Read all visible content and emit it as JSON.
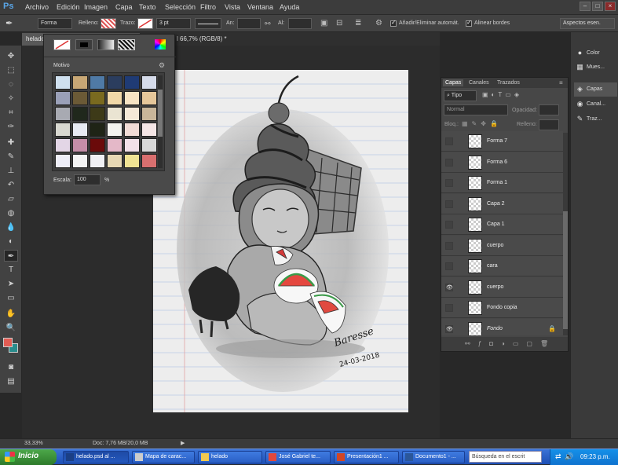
{
  "app": {
    "logo": "Ps"
  },
  "menu": [
    "Archivo",
    "Edición",
    "Imagen",
    "Capa",
    "Texto",
    "Selección",
    "Filtro",
    "Vista",
    "Ventana",
    "Ayuda"
  ],
  "window_buttons": [
    "–",
    "□",
    "×"
  ],
  "options": {
    "mode": "Forma",
    "fill_label": "Relleno:",
    "stroke_label": "Trazo:",
    "stroke_size": "3 pt",
    "width_label": "An:",
    "height_label": "Al:",
    "auto_add_label": "Añadir/Eliminar automát.",
    "align_edges_label": "Alinear bordes",
    "workspace": "Aspectos esen."
  },
  "document_tab": {
    "title": "helado",
    "title_rest": "l 66,7% (RGB/8) *"
  },
  "pattern_panel": {
    "title": "Motivo",
    "scale_label": "Escala:",
    "scale_value": "100",
    "scale_unit": "%",
    "swatches": [
      [
        "#cfe0ef",
        "#c8a775",
        "#4f7aa6",
        "#2b3d5e",
        "#1f3b75",
        "#d5dbea"
      ],
      [
        "#9aa0b8",
        "#6b5a36",
        "#7a6a1f",
        "#f2d9a8",
        "#f7e4c4",
        "#e6c79a"
      ],
      [
        "#a8aab2",
        "#20281c",
        "#3d3a18",
        "#eae4d2",
        "#f5e9d8",
        "#c9b69a"
      ],
      [
        "#d8d8d0",
        "#e8eaf4",
        "#1f2416",
        "#f4f4f0",
        "#f2dcd6",
        "#f5e6e6"
      ],
      [
        "#e3d6e6",
        "#c48ea8",
        "#6a0a0a",
        "#e4b8c8",
        "#f2e0e8",
        "#d9d9d9"
      ],
      [
        "#eeeef8",
        "#f4f4f4",
        "#f0f0f4",
        "#e7d8b4",
        "#f0e394",
        "#d96f6f"
      ]
    ]
  },
  "dock": [
    {
      "icon": "palette-icon",
      "glyph": "●",
      "label": "Color"
    },
    {
      "icon": "grid-icon",
      "glyph": "▦",
      "label": "Mues..."
    },
    {
      "icon": "layers-icon",
      "glyph": "◈",
      "label": "Capas"
    },
    {
      "icon": "channels-icon",
      "glyph": "◉",
      "label": "Canal..."
    },
    {
      "icon": "paths-icon",
      "glyph": "✎",
      "label": "Traz..."
    }
  ],
  "layers_panel": {
    "tabs": [
      "Capas",
      "Canales",
      "Trazados"
    ],
    "filter": "Tipo",
    "blend_mode": "Normal",
    "opacity_label": "Opacidad:",
    "lock_label": "Bloq.:",
    "fill_label": "Relleno:",
    "layers": [
      {
        "name": "Forma 7",
        "visible": false,
        "italic": false
      },
      {
        "name": "Forma 6",
        "visible": false,
        "italic": false
      },
      {
        "name": "Forma 1",
        "visible": false,
        "italic": false
      },
      {
        "name": "Capa 2",
        "visible": false,
        "italic": false
      },
      {
        "name": "Capa 1",
        "visible": false,
        "italic": false
      },
      {
        "name": "cuerpo",
        "visible": false,
        "italic": false
      },
      {
        "name": "cara",
        "visible": false,
        "italic": false
      },
      {
        "name": "cuerpo",
        "visible": true,
        "italic": false
      },
      {
        "name": "Fondo copia",
        "visible": false,
        "italic": false
      },
      {
        "name": "Fondo",
        "visible": true,
        "italic": true,
        "locked": true
      }
    ]
  },
  "canvas_text": {
    "signature": "Baresse",
    "date": "24-03-2018"
  },
  "status": {
    "zoom": "33,33%",
    "doc_size": "Doc: 7,76 MB/20,0 MB"
  },
  "taskbar": {
    "start": "Inicio",
    "items": [
      {
        "label": "helado.psd al ...",
        "icon": "photoshop-icon",
        "color": "#1b3f85"
      },
      {
        "label": "Mapa de carac...",
        "icon": "charmap-icon",
        "color": "#cccccc"
      },
      {
        "label": "helado",
        "icon": "folder-icon",
        "color": "#f1c94f"
      },
      {
        "label": "José Gabriel te...",
        "icon": "chrome-icon",
        "color": "#e1483c"
      },
      {
        "label": "Presentación1 ...",
        "icon": "powerpoint-icon",
        "color": "#d24625"
      },
      {
        "label": "Documento1 - ...",
        "icon": "word-icon",
        "color": "#2b579a"
      }
    ],
    "search_placeholder": "Búsqueda en el escrit",
    "time": "09:23 p.m."
  },
  "colors": {
    "foreground": "#e35d54",
    "background": "#2a8c8c",
    "accent": "#5aa6e8"
  }
}
